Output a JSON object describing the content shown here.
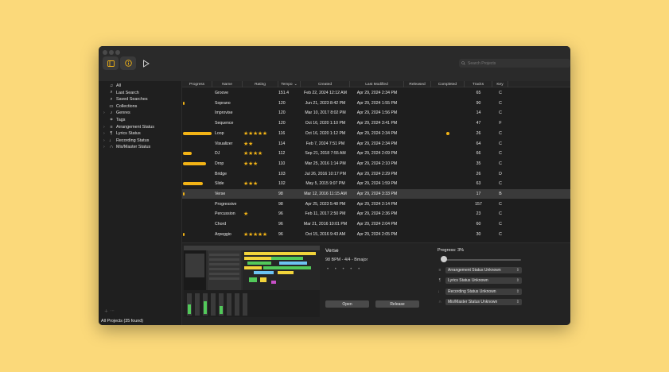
{
  "toolbar": {
    "sidebar_icon": "sidebar-toggle-icon",
    "info_icon": "info-icon",
    "play_icon": "play-icon",
    "search_placeholder": "Search Projects"
  },
  "sidebar": {
    "items": [
      {
        "label": "All",
        "icon": "music-note-icon",
        "chevron": false
      },
      {
        "label": "Last Search",
        "icon": "search-icon",
        "chevron": false
      },
      {
        "label": "Saved Searches",
        "icon": "saved-search-icon",
        "chevron": false
      },
      {
        "label": "Collections",
        "icon": "folder-icon",
        "chevron": false
      },
      {
        "label": "Genres",
        "icon": "guitar-icon",
        "chevron": true
      },
      {
        "label": "Tags",
        "icon": "tag-icon",
        "chevron": false
      },
      {
        "label": "Arrangement Status",
        "icon": "arrangement-icon",
        "chevron": true
      },
      {
        "label": "Lyrics Status",
        "icon": "lyrics-icon",
        "chevron": true
      },
      {
        "label": "Recording Status",
        "icon": "microphone-icon",
        "chevron": true
      },
      {
        "label": "Mix/Master Status",
        "icon": "headphones-icon",
        "chevron": true
      }
    ],
    "footer": "All Projects (35 found)"
  },
  "table": {
    "headers": [
      "Progress",
      "Name",
      "Rating",
      "Tempo",
      "Created",
      "Last Modified",
      "Released",
      "Completed",
      "Tracks",
      "Key"
    ],
    "sort_indicator": "⌄",
    "rows": [
      {
        "progress": 0,
        "name": "Groove",
        "rating": 0,
        "tempo": "151.4",
        "created": "Feb 22, 2024 12:12 AM",
        "modified": "Apr 29, 2024 2:34 PM",
        "completed": false,
        "tracks": "65",
        "key": "C"
      },
      {
        "progress": 0.05,
        "name": "Soprano",
        "rating": 0,
        "tempo": "120",
        "created": "Jun 21, 2023 8:42 PM",
        "modified": "Apr 29, 2024 1:55 PM",
        "completed": false,
        "tracks": "90",
        "key": "C"
      },
      {
        "progress": 0,
        "name": "Improvise",
        "rating": 0,
        "tempo": "120",
        "created": "Mar 10, 2017 8:02 PM",
        "modified": "Apr 29, 2024 1:56 PM",
        "completed": false,
        "tracks": "14",
        "key": "C"
      },
      {
        "progress": 0,
        "name": "Sequence",
        "rating": 0,
        "tempo": "120",
        "created": "Oct 16, 2020 1:10 PM",
        "modified": "Apr 29, 2024 3:41 PM",
        "completed": false,
        "tracks": "47",
        "key": "F"
      },
      {
        "progress": 0.95,
        "name": "Loop",
        "rating": 5,
        "tempo": "116",
        "created": "Oct 16, 2020 1:12 PM",
        "modified": "Apr 29, 2024 2:34 PM",
        "completed": true,
        "tracks": "26",
        "key": "C"
      },
      {
        "progress": 0,
        "name": "Visualizer",
        "rating": 2,
        "tempo": "114",
        "created": "Feb 7, 2024 7:51 PM",
        "modified": "Apr 29, 2024 2:34 PM",
        "completed": false,
        "tracks": "64",
        "key": "C"
      },
      {
        "progress": 0.3,
        "name": "DJ",
        "rating": 4,
        "tempo": "112",
        "created": "Sep 21, 2018 7:55 AM",
        "modified": "Apr 29, 2024 2:09 PM",
        "completed": false,
        "tracks": "66",
        "key": "C"
      },
      {
        "progress": 0.75,
        "name": "Drop",
        "rating": 3,
        "tempo": "110",
        "created": "Mar 25, 2016 1:14 PM",
        "modified": "Apr 29, 2024 2:10 PM",
        "completed": false,
        "tracks": "35",
        "key": "C"
      },
      {
        "progress": 0,
        "name": "Bridge",
        "rating": 0,
        "tempo": "103",
        "created": "Jul 26, 2016 10:17 PM",
        "modified": "Apr 29, 2024 2:29 PM",
        "completed": false,
        "tracks": "26",
        "key": "D"
      },
      {
        "progress": 0.65,
        "name": "Slide",
        "rating": 3,
        "tempo": "102",
        "created": "May 5, 2015 9:07 PM",
        "modified": "Apr 29, 2024 1:59 PM",
        "completed": false,
        "tracks": "63",
        "key": "C"
      },
      {
        "progress": 0.03,
        "name": "Verse",
        "rating": 0,
        "tempo": "98",
        "created": "Mar 12, 2016 11:15 AM",
        "modified": "Apr 29, 2024 3:33 PM",
        "completed": false,
        "tracks": "17",
        "key": "B",
        "selected": true
      },
      {
        "progress": 0,
        "name": "Progressive",
        "rating": 0,
        "tempo": "98",
        "created": "Apr 25, 2023 5:48 PM",
        "modified": "Apr 29, 2024 2:14 PM",
        "completed": false,
        "tracks": "157",
        "key": "C"
      },
      {
        "progress": 0,
        "name": "Percussion",
        "rating": 1,
        "tempo": "96",
        "created": "Feb 11, 2017 2:50 PM",
        "modified": "Apr 29, 2024 2:36 PM",
        "completed": false,
        "tracks": "23",
        "key": "C"
      },
      {
        "progress": 0,
        "name": "Chord",
        "rating": 0,
        "tempo": "96",
        "created": "Mar 21, 2016 10:01 PM",
        "modified": "Apr 29, 2024 2:04 PM",
        "completed": false,
        "tracks": "60",
        "key": "C"
      },
      {
        "progress": 0.05,
        "name": "Arpeggio",
        "rating": 5,
        "tempo": "96",
        "created": "Oct 15, 2016 9:43 AM",
        "modified": "Apr 29, 2024 2:05 PM",
        "completed": false,
        "tracks": "30",
        "key": "C"
      },
      {
        "progress": 0.05,
        "name": "Melody",
        "rating": 0,
        "tempo": "96",
        "created": "Oct 16, 2020 1:08 PM",
        "modified": "Apr 29, 2024 3:32 PM",
        "completed": false,
        "tracks": "35",
        "key": "E"
      }
    ]
  },
  "detail": {
    "title": "Verse",
    "subtitle": "98 BPM - 4/4 - Bmajor",
    "dots": "• • • • •",
    "open_label": "Open",
    "release_label": "Release",
    "progress_label": "Progress: 3%",
    "progress_value": 0.03,
    "statuses": [
      {
        "label": "Arrangement Status Unknown",
        "icon": "arrangement-icon"
      },
      {
        "label": "Lyrics Status Unknown",
        "icon": "lyrics-icon"
      },
      {
        "label": "Recording Status Unknown",
        "icon": "microphone-icon"
      },
      {
        "label": "Mix/Master Status Unknown",
        "icon": "headphones-icon"
      }
    ]
  },
  "colors": {
    "background": "#FBD97A",
    "accent": "#F2B316",
    "window": "#1f1f1f"
  }
}
